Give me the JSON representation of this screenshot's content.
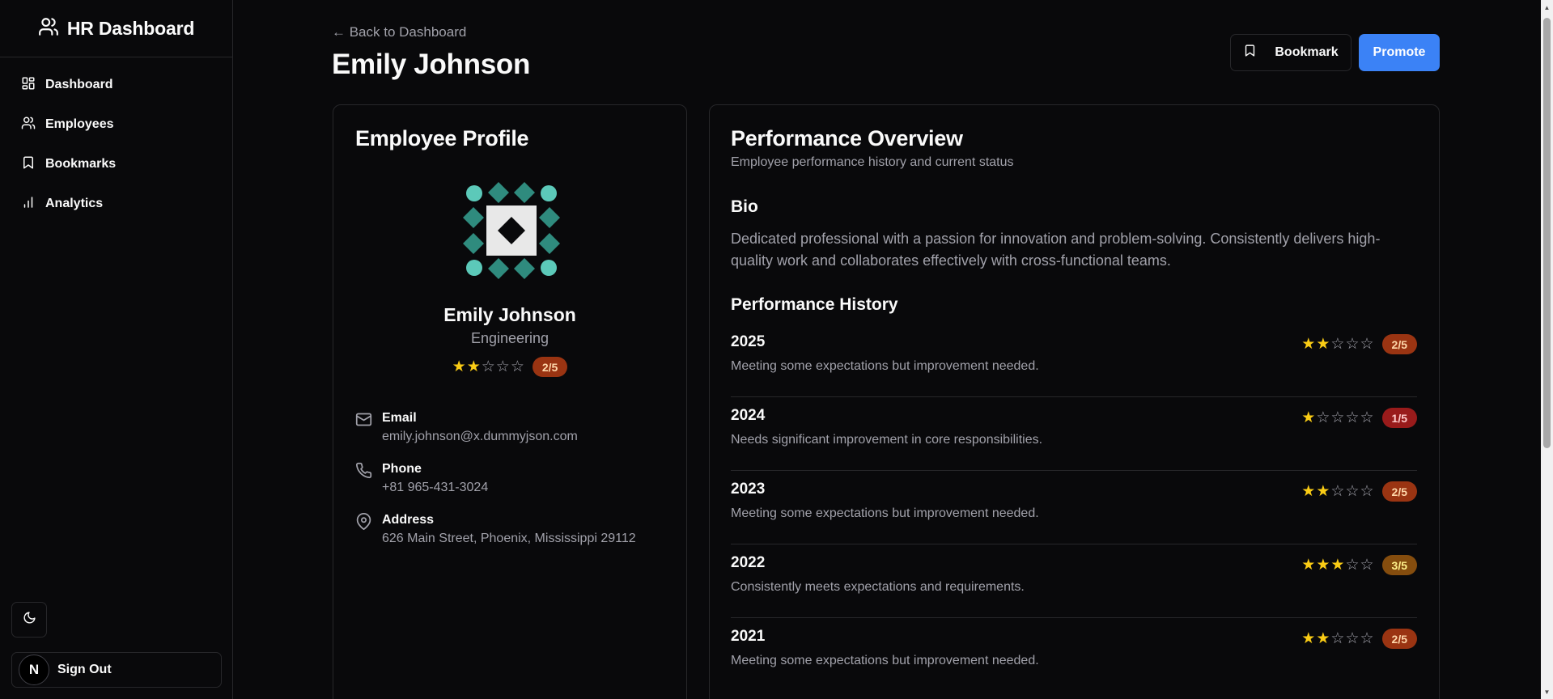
{
  "sidebar": {
    "brand": "HR Dashboard",
    "items": [
      {
        "label": "Dashboard",
        "icon": "layout-dashboard-icon"
      },
      {
        "label": "Employees",
        "icon": "users-icon"
      },
      {
        "label": "Bookmarks",
        "icon": "bookmark-icon"
      },
      {
        "label": "Analytics",
        "icon": "bar-chart-icon"
      }
    ],
    "theme_icon": "moon-icon",
    "signout_label": "Sign Out",
    "avatar_letter": "N"
  },
  "header": {
    "back_link": "← Back to Dashboard",
    "title": "Emily Johnson",
    "bookmark_label": "Bookmark",
    "promote_label": "Promote"
  },
  "profile": {
    "card_title": "Employee Profile",
    "name": "Emily Johnson",
    "department": "Engineering",
    "rating": 2,
    "rating_label": "2/5",
    "email_label": "Email",
    "email": "emily.johnson@x.dummyjson.com",
    "phone_label": "Phone",
    "phone": "+81 965-431-3024",
    "address_label": "Address",
    "address": "626 Main Street, Phoenix, Mississippi 29112"
  },
  "performance": {
    "card_title": "Performance Overview",
    "subtitle": "Employee performance history and current status",
    "bio_title": "Bio",
    "bio_text": "Dedicated professional with a passion for innovation and problem-solving. Consistently delivers high-quality work and collaborates effectively with cross-functional teams.",
    "history_title": "Performance History",
    "history": [
      {
        "year": "2025",
        "rating": 2,
        "label": "2/5",
        "desc": "Meeting some expectations but improvement needed."
      },
      {
        "year": "2024",
        "rating": 1,
        "label": "1/5",
        "desc": "Needs significant improvement in core responsibilities."
      },
      {
        "year": "2023",
        "rating": 2,
        "label": "2/5",
        "desc": "Meeting some expectations but improvement needed."
      },
      {
        "year": "2022",
        "rating": 3,
        "label": "3/5",
        "desc": "Consistently meets expectations and requirements."
      },
      {
        "year": "2021",
        "rating": 2,
        "label": "2/5",
        "desc": "Meeting some expectations but improvement needed."
      }
    ]
  },
  "colors": {
    "accent": "#3b82f6",
    "star": "#facc15",
    "badge_1": "#991b1b",
    "badge_2": "#9a3412",
    "badge_3": "#854d0e"
  }
}
